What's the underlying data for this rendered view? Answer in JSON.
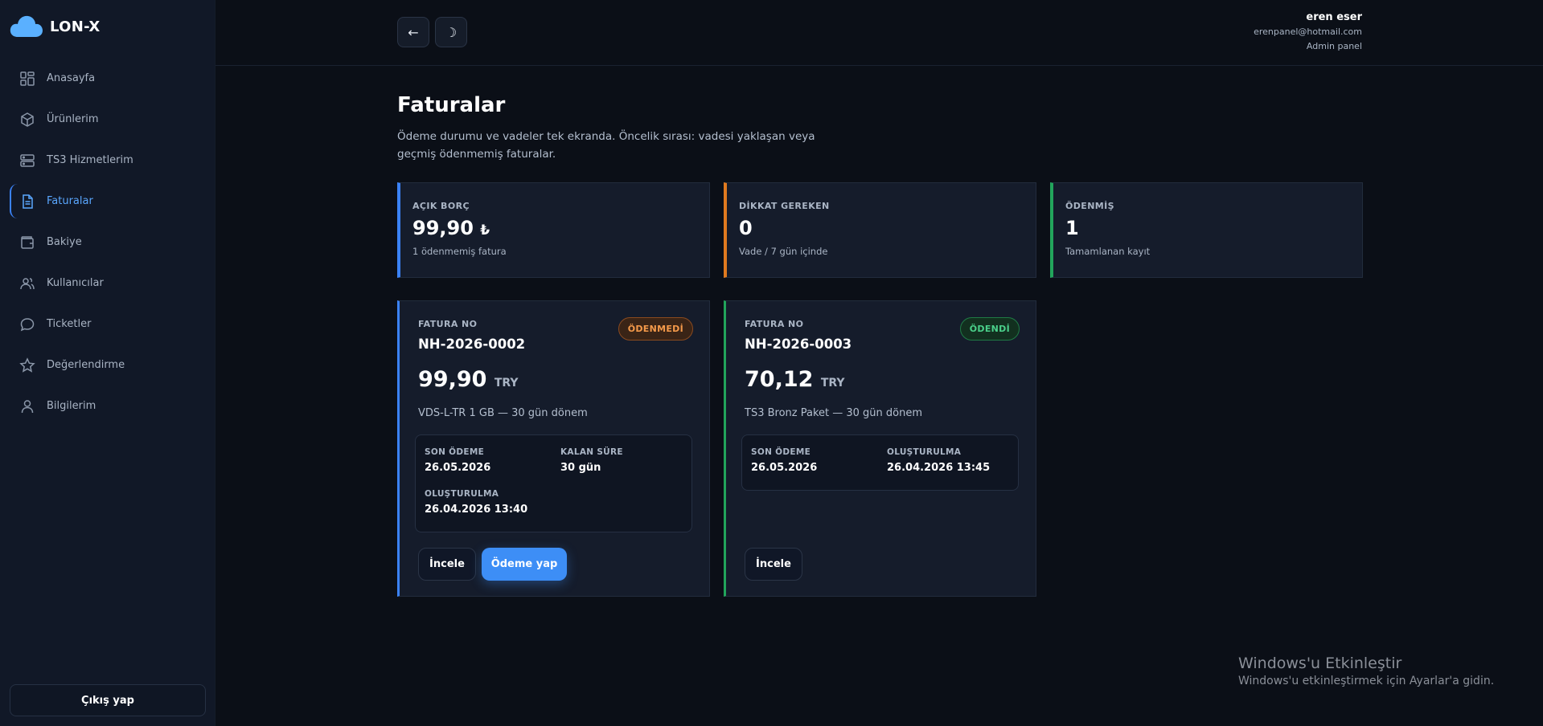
{
  "brand": {
    "name": "LON-X",
    "icon": "cloud-icon",
    "accent": "#5ab0ff"
  },
  "sidebar": {
    "items": [
      {
        "label": "Anasayfa",
        "icon": "dashboard-icon"
      },
      {
        "label": "Ürünlerim",
        "icon": "box-icon"
      },
      {
        "label": "TS3 Hizmetlerim",
        "icon": "server-icon"
      },
      {
        "label": "Faturalar",
        "icon": "document-icon",
        "active": true
      },
      {
        "label": "Bakiye",
        "icon": "wallet-icon"
      },
      {
        "label": "Kullanıcılar",
        "icon": "users-icon"
      },
      {
        "label": "Ticketler",
        "icon": "chat-icon"
      },
      {
        "label": "Değerlendirme",
        "icon": "star-icon"
      },
      {
        "label": "Bilgilerim",
        "icon": "user-icon"
      }
    ],
    "logout_label": "Çıkış yap"
  },
  "header": {
    "back_icon": "←",
    "theme_icon": "☽",
    "user": {
      "name": "eren eser",
      "email": "erenpanel@hotmail.com",
      "role": "Admin panel"
    }
  },
  "main": {
    "title": "Faturalar",
    "description": "Ödeme durumu ve vadeler tek ekranda. Öncelik sırası: vadesi yaklaşan veya geçmiş ödenmemiş faturalar."
  },
  "stats": [
    {
      "label": "AÇIK BORÇ",
      "value": "99,90",
      "currency": "₺",
      "sub": "1 ödenmemiş fatura",
      "color": "#3b82f6"
    },
    {
      "label": "DİKKAT GEREKEN",
      "value": "0",
      "currency": "",
      "sub": "Vade / 7 gün içinde",
      "color": "#e07a1f"
    },
    {
      "label": "ÖDENMİŞ",
      "value": "1",
      "currency": "",
      "sub": "Tamamlanan kayıt",
      "color": "#22a55b"
    }
  ],
  "invoices": [
    {
      "number_label": "FATURA NO",
      "number": "NH-2026-0002",
      "status": "ÖDENMEDİ",
      "amount": "99,90",
      "currency": "TRY",
      "description": "VDS-L-TR 1 GB — 30 gün dönem",
      "due_label": "SON ÖDEME",
      "due": "26.05.2026",
      "remaining_label": "KALAN SÜRE",
      "remaining": "30 gün",
      "created_label": "OLUŞTURULMA",
      "created": "26.04.2026 13:40",
      "view_label": "İncele",
      "pay_label": "Ödeme yap"
    },
    {
      "number_label": "FATURA NO",
      "number": "NH-2026-0003",
      "status": "ÖDENDİ",
      "amount": "70,12",
      "currency": "TRY",
      "description": "TS3 Bronz Paket — 30 gün dönem",
      "due_label": "SON ÖDEME",
      "due": "26.05.2026",
      "created_label": "OLUŞTURULMA",
      "created": "26.04.2026 13:45",
      "view_label": "İncele"
    }
  ],
  "watermark": {
    "title": "Windows'u Etkinleştir",
    "subtitle": "Windows'u etkinleştirmek için Ayarlar'a gidin."
  },
  "colors": {
    "unpaid_border": "#3b82f6",
    "paid_border": "#22a55b",
    "unpaid_badge": "#f59a4a",
    "paid_badge": "#4ad08a"
  }
}
